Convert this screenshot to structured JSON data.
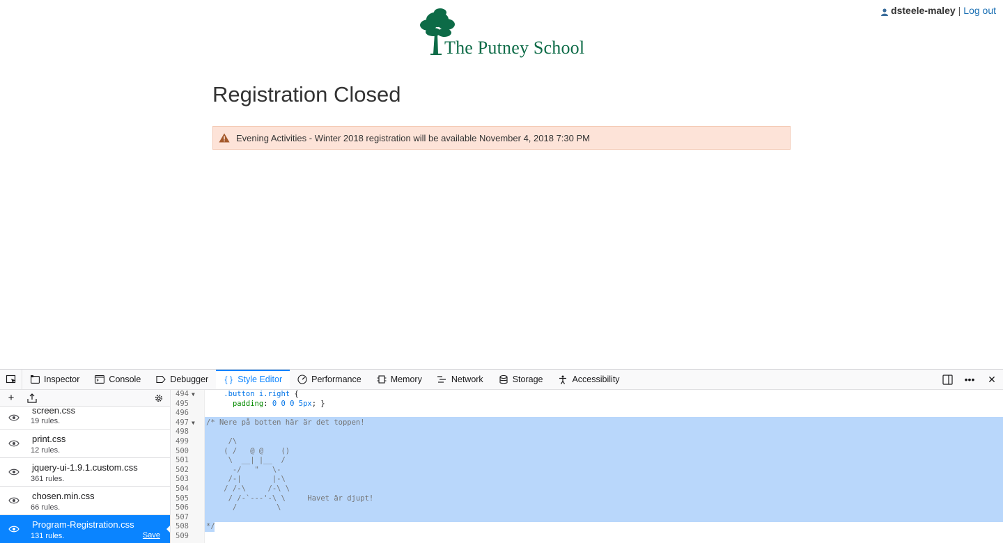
{
  "userbar": {
    "username": "dsteele-maley",
    "separator": "|",
    "logout_label": "Log out"
  },
  "logo": {
    "text": "The Putney School"
  },
  "page": {
    "title": "Registration Closed",
    "alert": "Evening Activities - Winter 2018 registration will be available November 4, 2018 7:30 PM"
  },
  "devtools": {
    "tabs": [
      {
        "label": "Inspector",
        "icon": "inspector-icon"
      },
      {
        "label": "Console",
        "icon": "console-icon"
      },
      {
        "label": "Debugger",
        "icon": "debugger-icon"
      },
      {
        "label": "Style Editor",
        "icon": "braces-icon",
        "active": true
      },
      {
        "label": "Performance",
        "icon": "performance-icon"
      },
      {
        "label": "Memory",
        "icon": "memory-icon"
      },
      {
        "label": "Network",
        "icon": "network-icon"
      },
      {
        "label": "Storage",
        "icon": "storage-icon"
      },
      {
        "label": "Accessibility",
        "icon": "accessibility-icon"
      }
    ],
    "style_sheets": [
      {
        "name": "screen.css",
        "rules": "19 rules."
      },
      {
        "name": "print.css",
        "rules": "12 rules."
      },
      {
        "name": "jquery-ui-1.9.1.custom.css",
        "rules": "361 rules."
      },
      {
        "name": "chosen.min.css",
        "rules": "66 rules."
      },
      {
        "name": "Program-Registration.css",
        "rules": "131 rules.",
        "selected": true,
        "action": "Save"
      }
    ],
    "editor": {
      "accent_color": "#0a84ff",
      "selection_color": "#b9d7fb",
      "lines": [
        {
          "n": "494",
          "fold": "▼",
          "text": "    .button i.right {"
        },
        {
          "n": "495",
          "fold": "",
          "text": "      padding: 0 0 0 5px; }"
        },
        {
          "n": "496",
          "fold": "",
          "text": ""
        },
        {
          "n": "497",
          "fold": "▼",
          "text": "/* Nere på botten här är det toppen!"
        },
        {
          "n": "498",
          "fold": "",
          "text": ""
        },
        {
          "n": "499",
          "fold": "",
          "text": "     /\\"
        },
        {
          "n": "500",
          "fold": "",
          "text": "    ( /   @ @    ()"
        },
        {
          "n": "501",
          "fold": "",
          "text": "     \\  __| |__  /"
        },
        {
          "n": "502",
          "fold": "",
          "text": "      -/   \"   \\-"
        },
        {
          "n": "503",
          "fold": "",
          "text": "     /-|       |-\\"
        },
        {
          "n": "504",
          "fold": "",
          "text": "    / /-\\     /-\\ \\"
        },
        {
          "n": "505",
          "fold": "",
          "text": "     / /-`---'-\\ \\     Havet är djupt!"
        },
        {
          "n": "506",
          "fold": "",
          "text": "      /         \\"
        },
        {
          "n": "507",
          "fold": "",
          "text": ""
        },
        {
          "n": "508",
          "fold": "",
          "text": "*/"
        },
        {
          "n": "509",
          "fold": "",
          "text": ""
        }
      ]
    }
  }
}
